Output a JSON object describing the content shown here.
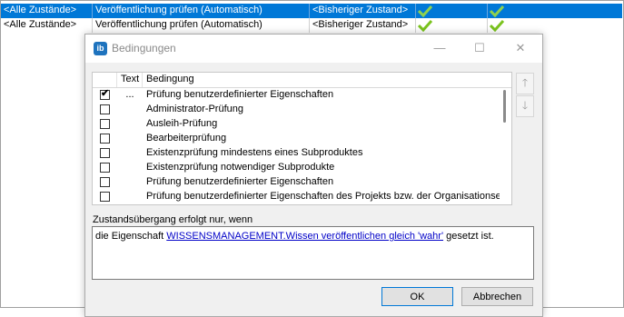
{
  "background_rows": [
    {
      "state_from": "<Alle Zustände>",
      "action": "Veröffentlichung prüfen (Automatisch)",
      "state_to": "<Bisheriger Zustand>",
      "check_icons": [
        "check-icon",
        "check-icon"
      ],
      "selected": true
    },
    {
      "state_from": "<Alle Zustände>",
      "action": "Veröffentlichung prüfen (Automatisch)",
      "state_to": "<Bisheriger Zustand>",
      "check_icons": [
        "check-icon",
        "check-icon"
      ],
      "selected": false
    }
  ],
  "dialog": {
    "app_icon_text": "ib",
    "title": "Bedingungen",
    "minimize_glyph": "—",
    "maximize_glyph": "☐",
    "close_glyph": "✕",
    "table": {
      "columns": [
        "Text",
        "Bedingung"
      ],
      "rows": [
        {
          "checked": true,
          "text": "...",
          "condition": "Prüfung benutzerdefinierter Eigenschaften"
        },
        {
          "checked": false,
          "text": "",
          "condition": "Administrator-Prüfung"
        },
        {
          "checked": false,
          "text": "",
          "condition": "Ausleih-Prüfung"
        },
        {
          "checked": false,
          "text": "",
          "condition": "Bearbeiterprüfung"
        },
        {
          "checked": false,
          "text": "",
          "condition": "Existenzprüfung mindestens eines Subproduktes"
        },
        {
          "checked": false,
          "text": "",
          "condition": "Existenzprüfung notwendiger Subprodukte"
        },
        {
          "checked": false,
          "text": "",
          "condition": "Prüfung benutzerdefinierter Eigenschaften"
        },
        {
          "checked": false,
          "text": "",
          "condition": "Prüfung benutzerdefinierter Eigenschaften des Projekts bzw. der Organisationseinheit"
        }
      ],
      "check_glyph": "✔"
    },
    "move_up_glyph": "🡑",
    "move_down_glyph": "🡓",
    "transition_label": "Zustandsübergang erfolgt nur, wenn",
    "rule": {
      "prefix": "die Eigenschaft ",
      "link": "WISSENSMANAGEMENT.Wissen veröffentlichen gleich 'wahr'",
      "suffix": " gesetzt ist."
    },
    "ok_label": "OK",
    "cancel_label": "Abbrechen"
  },
  "colors": {
    "selection": "#0078d7",
    "check_green": "#7ac31e",
    "link": "#0000c8"
  }
}
